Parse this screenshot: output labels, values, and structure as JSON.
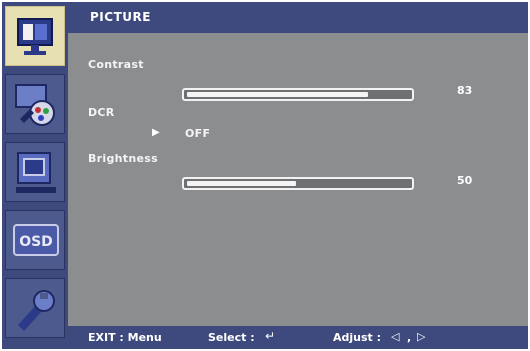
{
  "menu": {
    "title": "PICTURE",
    "sidebar": [
      {
        "icon": "monitor-picture-icon",
        "active": true
      },
      {
        "icon": "color-palette-icon",
        "active": false
      },
      {
        "icon": "image-position-icon",
        "active": false
      },
      {
        "icon": "osd-settings-icon",
        "active": false
      },
      {
        "icon": "setup-tools-icon",
        "active": false
      }
    ],
    "items": {
      "contrast": {
        "label": "Contrast",
        "value": "83",
        "level": 0.83
      },
      "dcr": {
        "label": "DCR",
        "option": "OFF"
      },
      "brightness": {
        "label": "Brightness",
        "value": "50",
        "level": 0.5
      }
    }
  },
  "footer": {
    "exit": "EXIT : Menu",
    "select": "Select :",
    "adjust": "Adjust :",
    "separator": ","
  },
  "colors": {
    "panel": "#8b8d8f",
    "bar": "#3e4a7d",
    "highlight": "#e6e0b3"
  }
}
